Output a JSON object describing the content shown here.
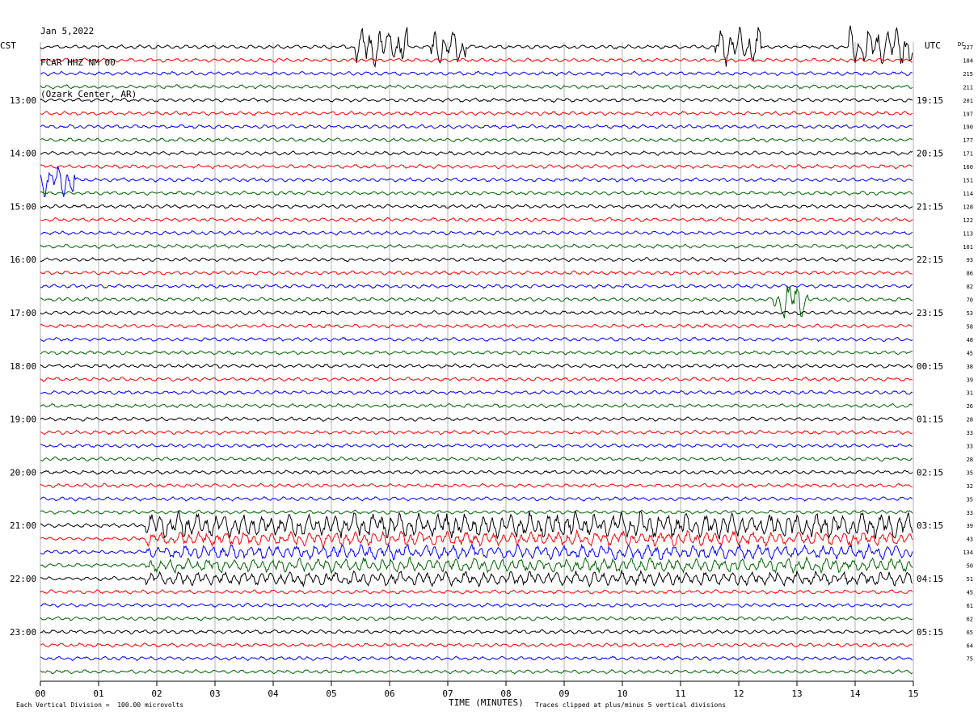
{
  "header": {
    "date": "Jan 5,2022",
    "station": "FCAR HHZ NM 00",
    "location": "(Ozark Center, AR)"
  },
  "left_axis_label": "CST",
  "right_axis_label": "UTC",
  "dc_label": "DC",
  "footer": {
    "scale_note": "Each Vertical Division =  100.00 microvolts",
    "clip_note": "Traces clipped at plus/minus 5 vertical divisions"
  },
  "colors": {
    "black": "#000000",
    "red": "#ff0000",
    "blue": "#0000ff",
    "green": "#006400",
    "grid": "#808080"
  },
  "chart_data": {
    "type": "line",
    "title": "",
    "xlabel": "TIME (MINUTES)",
    "ylabel": "",
    "x_range": [
      0,
      15
    ],
    "x_ticks": [
      "00",
      "01",
      "02",
      "03",
      "04",
      "05",
      "06",
      "07",
      "08",
      "09",
      "10",
      "11",
      "12",
      "13",
      "14",
      "15"
    ],
    "trace_colors": [
      "black",
      "red",
      "blue",
      "green"
    ],
    "trace_count": 48,
    "left_time_labels": [
      "13:00",
      "14:00",
      "15:00",
      "16:00",
      "17:00",
      "18:00",
      "19:00",
      "20:00",
      "21:00",
      "22:00",
      "23:00"
    ],
    "right_time_labels": [
      "19:15",
      "20:15",
      "21:15",
      "22:15",
      "23:15",
      "00:15",
      "01:15",
      "02:15",
      "03:15",
      "04:15",
      "05:15"
    ],
    "dc_offsets": [
      "227",
      "184",
      "215",
      "211",
      "201",
      "197",
      "190",
      "177",
      "171",
      "160",
      "151",
      "114",
      "128",
      "122",
      "113",
      "101",
      "93",
      "86",
      "82",
      "70",
      "53",
      "58",
      "48",
      "45",
      "38",
      "39",
      "31",
      "26",
      "28",
      "33",
      "33",
      "28",
      "35",
      "32",
      "35",
      "33",
      "39",
      "43",
      "134",
      "50",
      "51",
      "45",
      "61",
      "62",
      "65",
      "64",
      "75"
    ],
    "events": [
      {
        "trace": 0,
        "start_min": 5.4,
        "end_min": 6.3,
        "note": "clipped burst"
      },
      {
        "trace": 0,
        "start_min": 6.7,
        "end_min": 7.3,
        "note": "clipped burst"
      },
      {
        "trace": 0,
        "start_min": 11.6,
        "end_min": 12.4,
        "note": "clipped burst"
      },
      {
        "trace": 0,
        "start_min": 13.9,
        "end_min": 15.0,
        "note": "clipped burst"
      },
      {
        "trace": 10,
        "start_min": 0.0,
        "end_min": 0.6,
        "note": "large signal"
      },
      {
        "trace": 19,
        "start_min": 12.6,
        "end_min": 13.2,
        "note": "large signal"
      },
      {
        "trace": 36,
        "start_min": 1.8,
        "end_min": 15.0,
        "note": "earthquake onset and coda"
      }
    ]
  }
}
